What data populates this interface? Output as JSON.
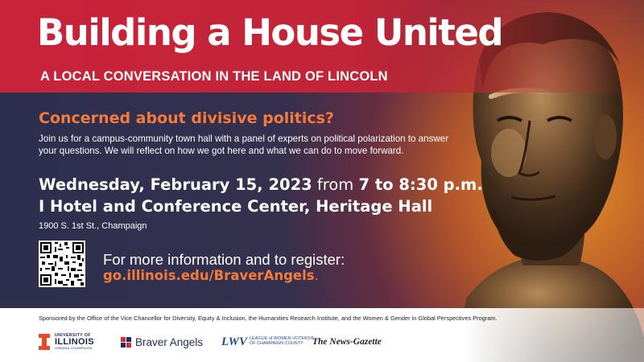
{
  "title": "Building a House United",
  "subtitle": "A LOCAL CONVERSATION IN THE LAND OF LINCOLN",
  "question": "Concerned about divisive politics?",
  "intro": "Join us for a campus-community town hall with a panel of experts on political polarization to answer your questions. We will reflect on how we got here and what we can do to move forward.",
  "event": {
    "date": "Wednesday, February 15, 2023",
    "from_word": "from",
    "time": "7 to 8:30 p.m.",
    "venue": "I Hotel and Conference Center, Heritage Hall",
    "address": "1900 S. 1st St., Champaign"
  },
  "register": {
    "label": "For more information and to register:",
    "link": "go.illinois.edu/BraverAngels",
    "link_suffix": "."
  },
  "footer": {
    "sponsor_text": "Sponsored by the Office of the Vice Chancellor for Diversity, Equity & Inclusion, the Humanities Research Institute, and the Women & Gender in Global Perspectives Program.",
    "logos": {
      "illinois_univ": "UNIVERSITY OF",
      "illinois_name": "ILLINOIS",
      "illinois_campus": "URBANA-CHAMPAIGN",
      "braver_angels": "Braver Angels",
      "lwv_mark": "LWV",
      "lwv_line1": "LEAGUE of WOMEN VOTERS®",
      "lwv_line2": "OF CHAMPAIGN COUNTY",
      "gazette": "The News-Gazette"
    }
  },
  "colors": {
    "red": "#c8233a",
    "orange": "#f47b3c",
    "navy": "#2d2f4f",
    "illinois_orange": "#e84a27",
    "illinois_blue": "#13294b"
  },
  "icons": [
    "lincoln-bust-image",
    "qr-code",
    "illinois-block-i-icon",
    "braver-angels-mark-icon"
  ]
}
